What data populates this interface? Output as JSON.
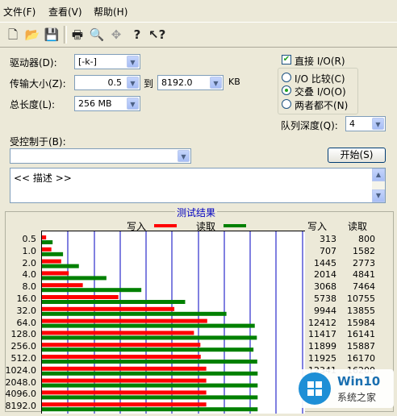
{
  "menu": {
    "file": "文件(F)",
    "view": "查看(V)",
    "help": "帮助(H)"
  },
  "toolbar": {
    "icons": [
      "new-icon",
      "open-icon",
      "save-icon",
      "print-icon",
      "print-preview-icon",
      "move-icon",
      "help-icon",
      "context-help-icon"
    ],
    "glyphs": [
      "🗋",
      "📂",
      "💾",
      "🖨",
      "🔍",
      "✥",
      "?",
      "❓"
    ]
  },
  "form": {
    "drive_label": "驱动器(D):",
    "drive_value": "[-k-]",
    "transfer_label": "传输大小(Z):",
    "transfer_from": "0.5",
    "to_label": "到",
    "transfer_to": "8192.0",
    "unit": "KB",
    "total_label": "总长度(L):",
    "total_value": "256 MB",
    "direct_io": "直接 I/O(R)",
    "direct_io_checked": true,
    "radio_io_compare": "I/O 比较(C)",
    "radio_overlap": "交叠 I/O(O)",
    "radio_neither": "两者都不(N)",
    "selected_radio": "overlap",
    "queue_label": "队列深度(Q):",
    "queue_value": "4",
    "controlled_label": "受控制于(B):",
    "controlled_value": "",
    "start_button": "开始(S)",
    "description": "<< 描述 >>"
  },
  "results": {
    "title": "测试结果",
    "legend_write": "写入",
    "legend_read": "读取",
    "col_write": "写入",
    "col_read": "读取"
  },
  "colors": {
    "write": "#ff0000",
    "read": "#008000",
    "grid": "#0000c0",
    "title": "#0000c0"
  },
  "chart_data": {
    "type": "bar",
    "categories": [
      "0.5",
      "1.0",
      "2.0",
      "4.0",
      "8.0",
      "16.0",
      "32.0",
      "64.0",
      "128.0",
      "256.0",
      "512.0",
      "1024.0",
      "2048.0",
      "4096.0",
      "8192.0"
    ],
    "series": [
      {
        "name": "写入",
        "values": [
          313,
          707,
          1445,
          2014,
          3068,
          5738,
          9944,
          12412,
          11417,
          11899,
          11925,
          12341,
          null,
          null,
          null
        ]
      },
      {
        "name": "读取",
        "values": [
          800,
          1582,
          2773,
          4841,
          7464,
          10755,
          13855,
          15984,
          16141,
          15887,
          16170,
          16200,
          null,
          null,
          null
        ]
      }
    ],
    "xlim": [
      0,
      20000
    ]
  },
  "watermark": {
    "brand": "Win10",
    "sub": "系统之家"
  }
}
